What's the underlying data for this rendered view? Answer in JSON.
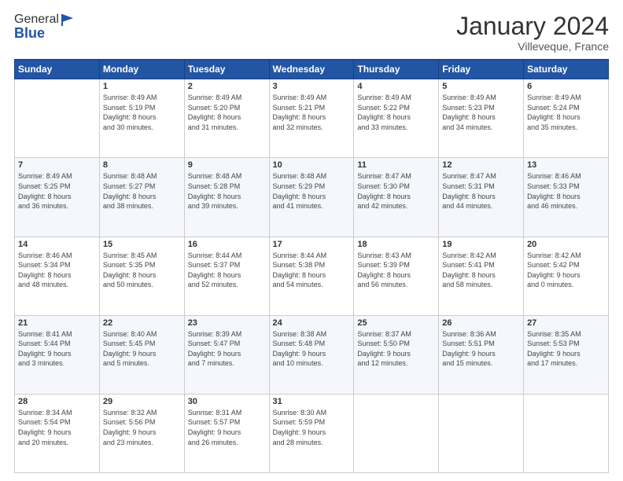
{
  "header": {
    "logo_general": "General",
    "logo_blue": "Blue",
    "title": "January 2024",
    "subtitle": "Villeveque, France"
  },
  "days_of_week": [
    "Sunday",
    "Monday",
    "Tuesday",
    "Wednesday",
    "Thursday",
    "Friday",
    "Saturday"
  ],
  "weeks": [
    [
      {
        "day": "",
        "info": ""
      },
      {
        "day": "1",
        "info": "Sunrise: 8:49 AM\nSunset: 5:19 PM\nDaylight: 8 hours\nand 30 minutes."
      },
      {
        "day": "2",
        "info": "Sunrise: 8:49 AM\nSunset: 5:20 PM\nDaylight: 8 hours\nand 31 minutes."
      },
      {
        "day": "3",
        "info": "Sunrise: 8:49 AM\nSunset: 5:21 PM\nDaylight: 8 hours\nand 32 minutes."
      },
      {
        "day": "4",
        "info": "Sunrise: 8:49 AM\nSunset: 5:22 PM\nDaylight: 8 hours\nand 33 minutes."
      },
      {
        "day": "5",
        "info": "Sunrise: 8:49 AM\nSunset: 5:23 PM\nDaylight: 8 hours\nand 34 minutes."
      },
      {
        "day": "6",
        "info": "Sunrise: 8:49 AM\nSunset: 5:24 PM\nDaylight: 8 hours\nand 35 minutes."
      }
    ],
    [
      {
        "day": "7",
        "info": "Sunrise: 8:49 AM\nSunset: 5:25 PM\nDaylight: 8 hours\nand 36 minutes."
      },
      {
        "day": "8",
        "info": "Sunrise: 8:48 AM\nSunset: 5:27 PM\nDaylight: 8 hours\nand 38 minutes."
      },
      {
        "day": "9",
        "info": "Sunrise: 8:48 AM\nSunset: 5:28 PM\nDaylight: 8 hours\nand 39 minutes."
      },
      {
        "day": "10",
        "info": "Sunrise: 8:48 AM\nSunset: 5:29 PM\nDaylight: 8 hours\nand 41 minutes."
      },
      {
        "day": "11",
        "info": "Sunrise: 8:47 AM\nSunset: 5:30 PM\nDaylight: 8 hours\nand 42 minutes."
      },
      {
        "day": "12",
        "info": "Sunrise: 8:47 AM\nSunset: 5:31 PM\nDaylight: 8 hours\nand 44 minutes."
      },
      {
        "day": "13",
        "info": "Sunrise: 8:46 AM\nSunset: 5:33 PM\nDaylight: 8 hours\nand 46 minutes."
      }
    ],
    [
      {
        "day": "14",
        "info": "Sunrise: 8:46 AM\nSunset: 5:34 PM\nDaylight: 8 hours\nand 48 minutes."
      },
      {
        "day": "15",
        "info": "Sunrise: 8:45 AM\nSunset: 5:35 PM\nDaylight: 8 hours\nand 50 minutes."
      },
      {
        "day": "16",
        "info": "Sunrise: 8:44 AM\nSunset: 5:37 PM\nDaylight: 8 hours\nand 52 minutes."
      },
      {
        "day": "17",
        "info": "Sunrise: 8:44 AM\nSunset: 5:38 PM\nDaylight: 8 hours\nand 54 minutes."
      },
      {
        "day": "18",
        "info": "Sunrise: 8:43 AM\nSunset: 5:39 PM\nDaylight: 8 hours\nand 56 minutes."
      },
      {
        "day": "19",
        "info": "Sunrise: 8:42 AM\nSunset: 5:41 PM\nDaylight: 8 hours\nand 58 minutes."
      },
      {
        "day": "20",
        "info": "Sunrise: 8:42 AM\nSunset: 5:42 PM\nDaylight: 9 hours\nand 0 minutes."
      }
    ],
    [
      {
        "day": "21",
        "info": "Sunrise: 8:41 AM\nSunset: 5:44 PM\nDaylight: 9 hours\nand 3 minutes."
      },
      {
        "day": "22",
        "info": "Sunrise: 8:40 AM\nSunset: 5:45 PM\nDaylight: 9 hours\nand 5 minutes."
      },
      {
        "day": "23",
        "info": "Sunrise: 8:39 AM\nSunset: 5:47 PM\nDaylight: 9 hours\nand 7 minutes."
      },
      {
        "day": "24",
        "info": "Sunrise: 8:38 AM\nSunset: 5:48 PM\nDaylight: 9 hours\nand 10 minutes."
      },
      {
        "day": "25",
        "info": "Sunrise: 8:37 AM\nSunset: 5:50 PM\nDaylight: 9 hours\nand 12 minutes."
      },
      {
        "day": "26",
        "info": "Sunrise: 8:36 AM\nSunset: 5:51 PM\nDaylight: 9 hours\nand 15 minutes."
      },
      {
        "day": "27",
        "info": "Sunrise: 8:35 AM\nSunset: 5:53 PM\nDaylight: 9 hours\nand 17 minutes."
      }
    ],
    [
      {
        "day": "28",
        "info": "Sunrise: 8:34 AM\nSunset: 5:54 PM\nDaylight: 9 hours\nand 20 minutes."
      },
      {
        "day": "29",
        "info": "Sunrise: 8:32 AM\nSunset: 5:56 PM\nDaylight: 9 hours\nand 23 minutes."
      },
      {
        "day": "30",
        "info": "Sunrise: 8:31 AM\nSunset: 5:57 PM\nDaylight: 9 hours\nand 26 minutes."
      },
      {
        "day": "31",
        "info": "Sunrise: 8:30 AM\nSunset: 5:59 PM\nDaylight: 9 hours\nand 28 minutes."
      },
      {
        "day": "",
        "info": ""
      },
      {
        "day": "",
        "info": ""
      },
      {
        "day": "",
        "info": ""
      }
    ]
  ]
}
